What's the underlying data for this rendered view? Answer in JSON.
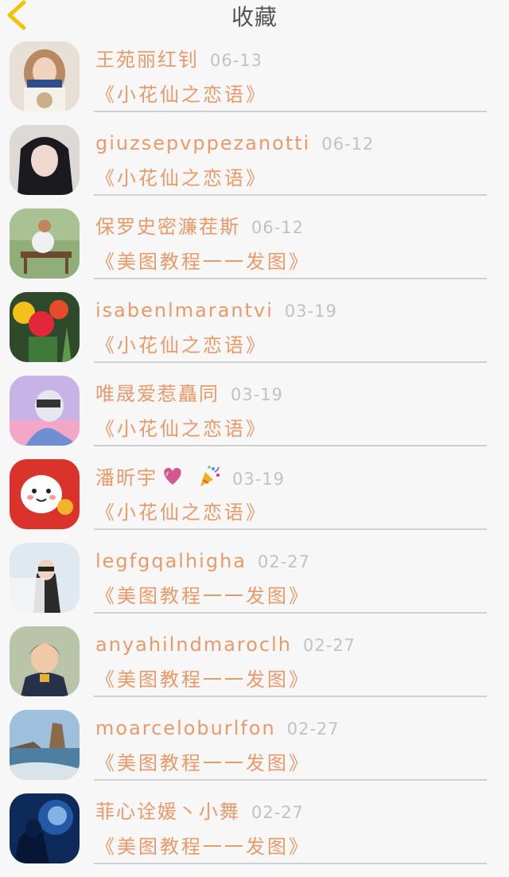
{
  "header": {
    "title": "收藏",
    "back_icon": "chevron-left-icon",
    "back_color": "#f2c300"
  },
  "items": [
    {
      "name": "王苑丽红钊",
      "date": "06-13",
      "book": "《小花仙之恋语》"
    },
    {
      "name": "giuzsepvppezanotti",
      "date": "06-12",
      "book": "《小花仙之恋语》"
    },
    {
      "name": "保罗史密濂茬斯",
      "date": "06-12",
      "book": "《美图教程一一发图》"
    },
    {
      "name": "isabenlmarantvi",
      "date": "03-19",
      "book": "《小花仙之恋语》"
    },
    {
      "name": "唯晟爱惹矗同",
      "date": "03-19",
      "book": "《小花仙之恋语》"
    },
    {
      "name": "潘昕宇",
      "date": "03-19",
      "book": "《小花仙之恋语》",
      "emoji": [
        "heart-icon",
        "party-popper-icon"
      ]
    },
    {
      "name": "legfgqalhigha",
      "date": "02-27",
      "book": "《美图教程一一发图》"
    },
    {
      "name": "anyahilndmaroclh",
      "date": "02-27",
      "book": "《美图教程一一发图》"
    },
    {
      "name": "moarceloburlfon",
      "date": "02-27",
      "book": "《美图教程一一发图》"
    },
    {
      "name": "菲心诠媛丶小舞",
      "date": "02-27",
      "book": "《美图教程一一发图》"
    }
  ],
  "colors": {
    "accent_text": "#e99a6a",
    "date_text": "#c2c2c2",
    "divider": "#d0d0d0",
    "background": "#f7f7f7"
  }
}
